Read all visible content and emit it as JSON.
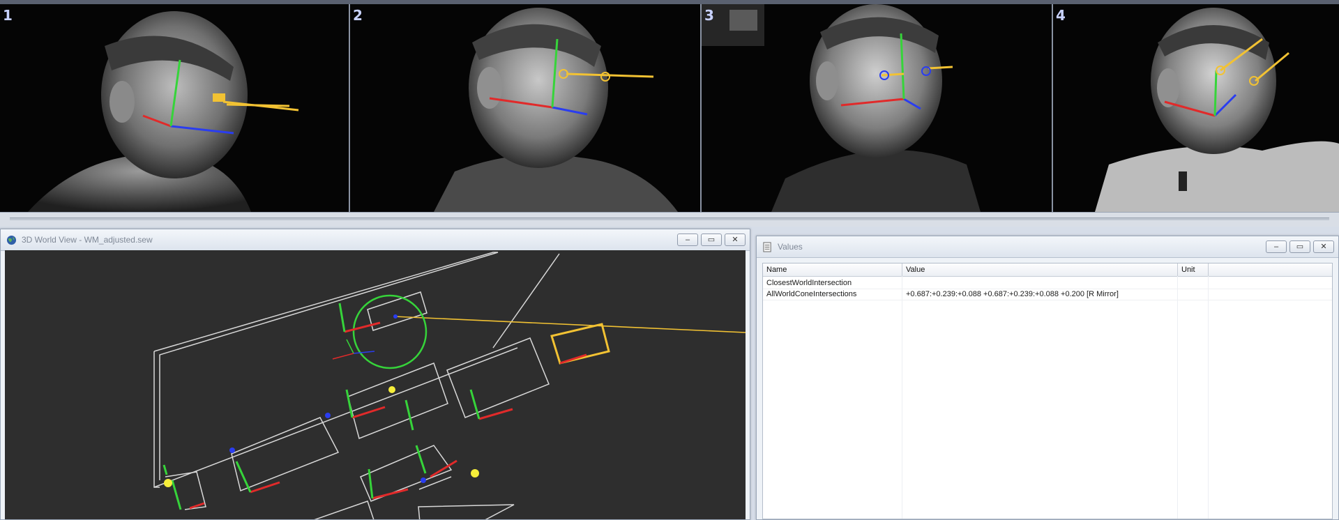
{
  "cameras": [
    {
      "label": "1"
    },
    {
      "label": "2"
    },
    {
      "label": "3"
    },
    {
      "label": "4"
    }
  ],
  "world_view": {
    "title": "3D World View - WM_adjusted.sew",
    "icon": "globe-icon"
  },
  "values_window": {
    "title": "Values",
    "icon": "document-icon",
    "columns": [
      "Name",
      "Value",
      "Unit"
    ],
    "rows": [
      {
        "name": "ClosestWorldIntersection",
        "value": "",
        "unit": ""
      },
      {
        "name": "AllWorldConeIntersections",
        "value": "+0.687:+0.239:+0.088 +0.687:+0.239:+0.088 +0.200 [R Mirror]",
        "unit": ""
      }
    ]
  },
  "window_buttons": {
    "minimize": "–",
    "maximize": "▭",
    "close": "✕"
  },
  "colors": {
    "axis_x": "#e12a2a",
    "axis_y": "#36d43a",
    "axis_z": "#2a3df0",
    "gaze": "#f2c233",
    "wire": "#d8d8d8"
  }
}
